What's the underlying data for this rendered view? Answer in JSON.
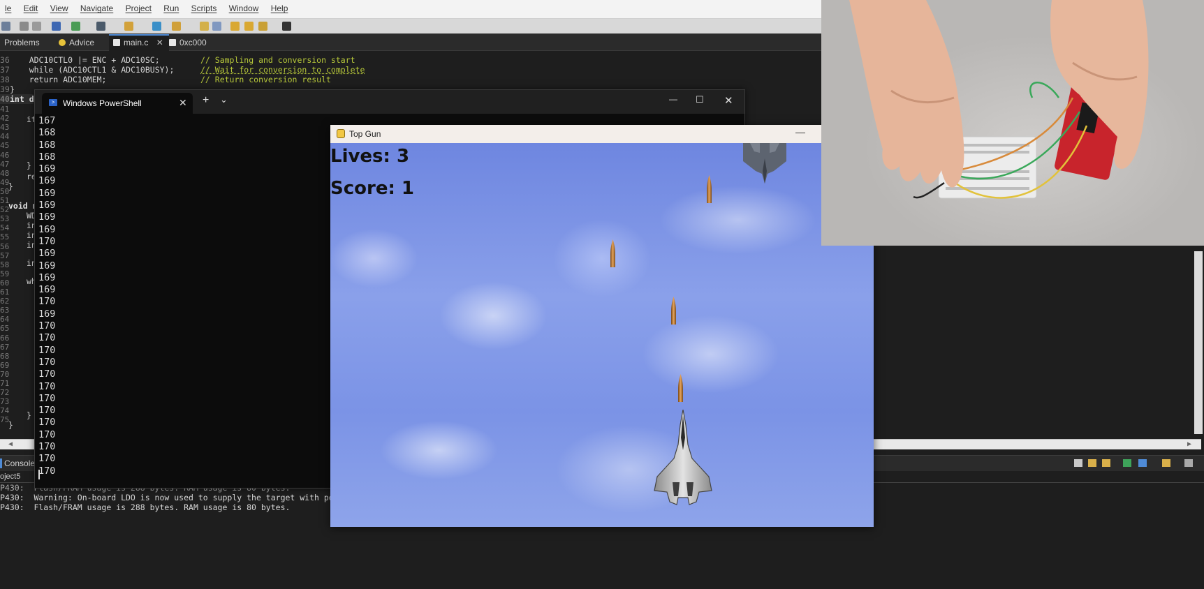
{
  "ide": {
    "menu": [
      "le",
      "Edit",
      "View",
      "Navigate",
      "Project",
      "Run",
      "Scripts",
      "Window",
      "Help"
    ],
    "tabs": [
      {
        "label": "Problems"
      },
      {
        "label": "Advice"
      },
      {
        "label": "main.c"
      },
      {
        "label": "0xc000"
      }
    ],
    "code_lines": [
      {
        "num": "36",
        "code": "    ADC10CTL0 |= ENC + ADC10SC;",
        "comment": "// Sampling and conversion start"
      },
      {
        "num": "37",
        "code": "    while (ADC10CTL1 & ADC10BUSY);",
        "comment": "// Wait for conversion to complete"
      },
      {
        "num": "38",
        "code": "    return ADC10MEM;",
        "comment": "// Return conversion result"
      },
      {
        "num": "39",
        "code": "}",
        "comment": ""
      },
      {
        "num": "40",
        "code": "int de",
        "comment": ""
      }
    ],
    "left_fragments": [
      "it",
      "}",
      "re",
      "}",
      "void m",
      "WD",
      "in",
      "in",
      "in",
      "in",
      "wh",
      "}",
      "}"
    ],
    "gutter": [
      "41",
      "42",
      "43",
      "44",
      "45",
      "46",
      "47",
      "48",
      "49",
      "50",
      "51",
      "52",
      "53",
      "54",
      "55",
      "56",
      "57",
      "58",
      "59",
      "60",
      "61",
      "62",
      "63",
      "64",
      "65",
      "66",
      "67",
      "68",
      "69",
      "70",
      "71",
      "72",
      "73",
      "74",
      "75"
    ],
    "console": {
      "tab_label": "Console",
      "project": "oject5",
      "lines": [
        "P430:  Flash/FRAM usage is 288 bytes. RAM usage is 80 bytes.",
        "P430:  Warning: On-board LDO is now used to supply the target with power",
        "P430:  Flash/FRAM usage is 288 bytes. RAM usage is 80 bytes."
      ]
    }
  },
  "powershell": {
    "tab_title": "Windows PowerShell",
    "new_tab": "+",
    "dropdown": "⌄",
    "controls": {
      "minimize": "—",
      "maximize": "☐",
      "close": "✕"
    },
    "lines": [
      "167",
      "168",
      "168",
      "168",
      "169",
      "169",
      "169",
      "169",
      "169",
      "169",
      "170",
      "169",
      "169",
      "169",
      "169",
      "170",
      "169",
      "170",
      "170",
      "170",
      "170",
      "170",
      "170",
      "170",
      "170",
      "170",
      "170",
      "170",
      "170",
      "170"
    ]
  },
  "game": {
    "title": "Top Gun",
    "minimize": "—",
    "lives_label": "Lives: 3",
    "score_label": "Score: 1",
    "lives": 3,
    "score": 1
  },
  "colors": {
    "ide_bg": "#1e1e1e",
    "comment": "#b8c93a",
    "sky": "#7b93e6",
    "board_red": "#c8242c"
  },
  "icons": [
    "powershell-icon",
    "pygame-icon",
    "fighter-jet-icon",
    "enemy-jet-icon",
    "bullet-icon"
  ]
}
